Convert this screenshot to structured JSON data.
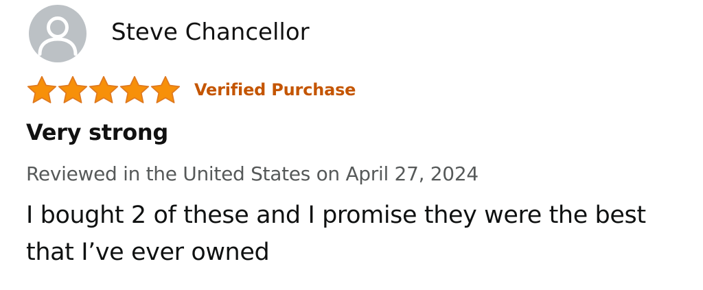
{
  "review": {
    "reviewer": {
      "name": "Steve Chancellor",
      "avatar_icon": "default-user-avatar-icon"
    },
    "rating": {
      "stars": 5,
      "max_stars": 5,
      "star_icon": "star-icon",
      "star_color": "#f79009"
    },
    "verified_label": "Verified Purchase",
    "title": "Very strong",
    "meta": "Reviewed in the United States on April 27, 2024",
    "body": "I bought 2 of these and I promise they were the best that I’ve ever owned"
  },
  "colors": {
    "verified": "#c45500",
    "meta_text": "#565959",
    "body_text": "#0f1111",
    "avatar_bg": "#bcc1c5"
  }
}
